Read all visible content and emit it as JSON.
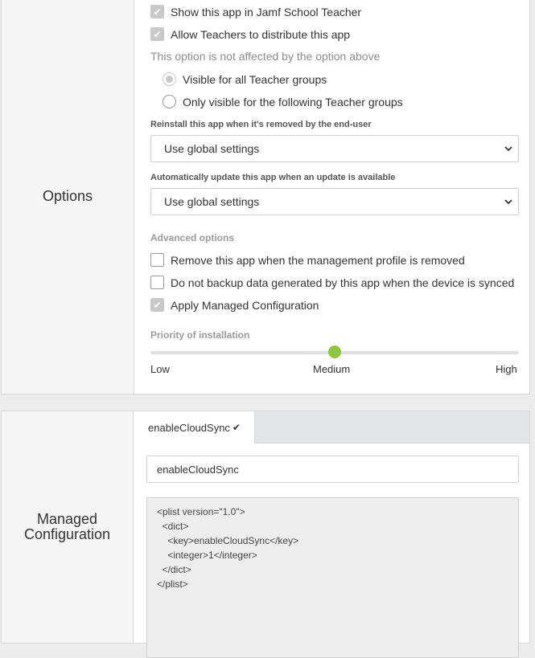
{
  "options": {
    "section_label": "Options",
    "show_in_teacher": {
      "label": "Show this app in Jamf School Teacher",
      "checked": true
    },
    "allow_distribute": {
      "label": "Allow Teachers to distribute this app",
      "checked": true
    },
    "not_affected_note": "This option is not affected by the option above",
    "visibility": {
      "all_groups": {
        "label": "Visible for all Teacher groups",
        "selected": true
      },
      "only_groups": {
        "label": "Only visible for the following Teacher groups",
        "selected": false
      }
    },
    "reinstall": {
      "label": "Reinstall this app when it's removed by the end-user",
      "value": "Use global settings"
    },
    "auto_update": {
      "label": "Automatically update this app when an update is available",
      "value": "Use global settings"
    },
    "advanced_title": "Advanced options",
    "remove_on_profile_removed": {
      "label": "Remove this app when the management profile is removed",
      "checked": false
    },
    "no_backup": {
      "label": "Do not backup data generated by this app when the device is synced",
      "checked": false
    },
    "apply_managed_config": {
      "label": "Apply Managed Configuration",
      "checked": true
    },
    "priority": {
      "title": "Priority of installation",
      "low": "Low",
      "medium": "Medium",
      "high": "High",
      "level": 0.5,
      "accent_color": "#8dc63f"
    }
  },
  "managed": {
    "section_label": "Managed Configuration",
    "tab_label": "enableCloudSync",
    "tab_check": "✔",
    "key_value": "enableCloudSync",
    "plist": "<plist version=\"1.0\">\n  <dict>\n    <key>enableCloudSync</key>\n    <integer>1</integer>\n  </dict>\n</plist>"
  }
}
